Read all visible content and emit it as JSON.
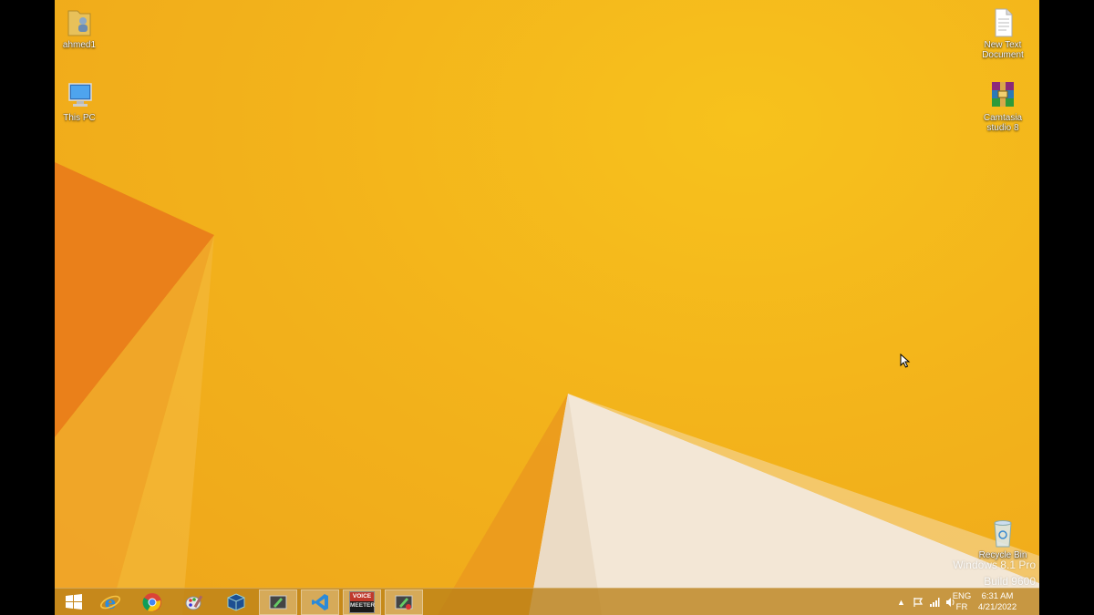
{
  "desktop": {
    "icons": [
      {
        "label": "ahmed1",
        "icon": "user-folder-icon"
      },
      {
        "label": "This PC",
        "icon": "computer-icon"
      },
      {
        "label": "New Text Document",
        "icon": "text-document-icon"
      },
      {
        "label": "Camtasia studio 8",
        "icon": "winrar-archive-icon"
      },
      {
        "label": "Recycle Bin",
        "icon": "recycle-bin-icon"
      }
    ],
    "watermark_line1": "Windows 8.1 Pro",
    "watermark_line2": "Build 9600"
  },
  "taskbar": {
    "apps": [
      {
        "name": "Start",
        "icon": "windows-start-icon"
      },
      {
        "name": "Internet Explorer",
        "icon": "internet-explorer-icon"
      },
      {
        "name": "Google Chrome",
        "icon": "chrome-icon"
      },
      {
        "name": "Paint",
        "icon": "paint-icon"
      },
      {
        "name": "VirtualBox",
        "icon": "virtualbox-icon"
      },
      {
        "name": "Camtasia Recorder",
        "icon": "camtasia-icon"
      },
      {
        "name": "Visual Studio Code",
        "icon": "vscode-icon"
      },
      {
        "name": "VoiceMeeter",
        "icon": "voicemeeter-icon",
        "text_top": "VOICE",
        "text_bottom": "MEETER"
      },
      {
        "name": "Camtasia Recorder Active",
        "icon": "camtasia-recorder-icon"
      }
    ],
    "tray": {
      "language_top": "ENG",
      "language_bottom": "FR",
      "time": "6:31 AM",
      "date": "4/21/2022"
    }
  },
  "colors": {
    "wallpaper": "#f3b31b",
    "taskbar": "#ba8018"
  }
}
